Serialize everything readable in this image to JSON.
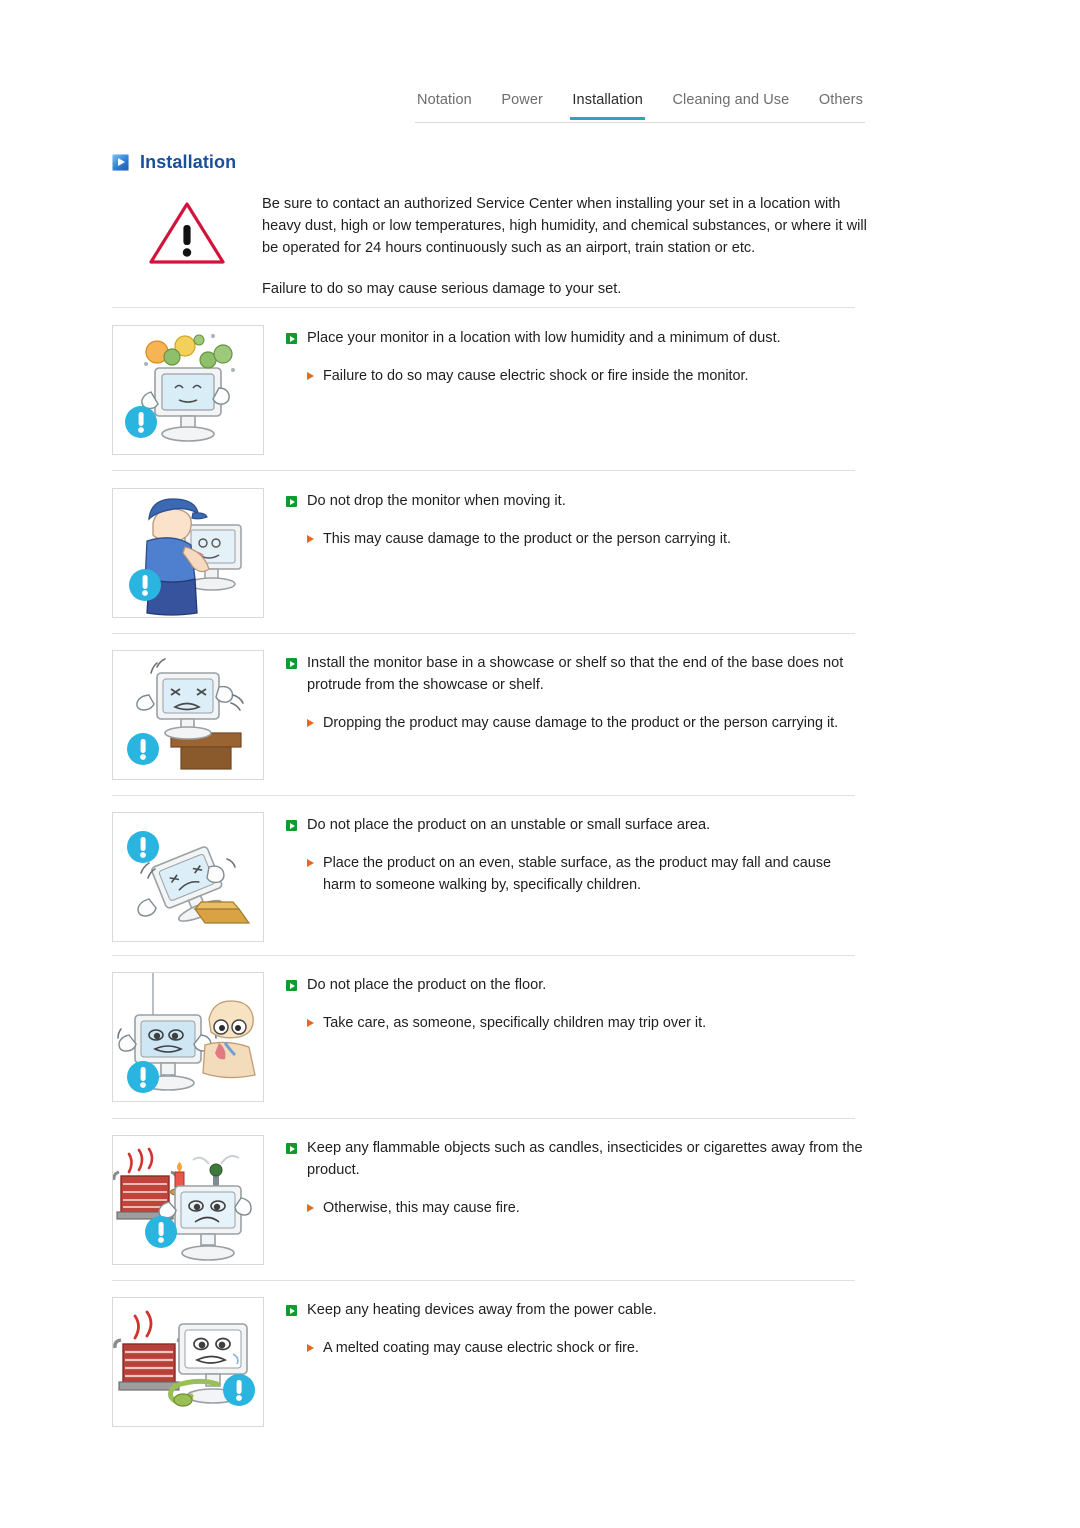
{
  "tabs": [
    {
      "label": "Notation",
      "active": false
    },
    {
      "label": "Power",
      "active": false
    },
    {
      "label": "Installation",
      "active": true
    },
    {
      "label": "Cleaning and Use",
      "active": false
    },
    {
      "label": "Others",
      "active": false
    }
  ],
  "header": {
    "title": "Installation",
    "icon": "blue-play-square-icon",
    "title_color": "#1b4f9c",
    "active_tab_underline_color": "#2aa7bd"
  },
  "intro": {
    "icon": "warning-triangle-icon",
    "icon_color": "#d1143c",
    "paragraph_1": "Be sure to contact an authorized Service Center when installing your set in a location with heavy dust, high or low temperatures, high humidity, and chemical substances, or where it will be operated for 24 hours continuously such as an airport, train station or etc.",
    "paragraph_2": "Failure to do so may cause serious damage to your set."
  },
  "colors": {
    "main_bullet": "#0f9b2e",
    "sub_bullet": "#e8671c",
    "caution_badge": "#2ab4e0",
    "divider": "#e0e0e0"
  },
  "rows": [
    {
      "illustration": "monitor-with-dust-particles-illustration",
      "badge": "caution-exclamation-badge",
      "main": "Place your monitor in a location with low humidity and a minimum of dust.",
      "sub": "Failure to do so may cause electric shock or fire inside the monitor."
    },
    {
      "illustration": "person-carrying-monitor-illustration",
      "badge": "caution-exclamation-badge",
      "main": "Do not drop the monitor when moving it.",
      "sub": "This may cause damage to the product or the person carrying it."
    },
    {
      "illustration": "monitor-on-shelf-edge-illustration",
      "badge": "caution-exclamation-badge",
      "main": "Install the monitor base in a showcase or shelf so that the end of the base does not protrude from the showcase or shelf.",
      "sub": "Dropping the product may cause damage to the product or the person carrying it."
    },
    {
      "illustration": "monitor-falling-off-small-surface-illustration",
      "badge": "caution-exclamation-badge",
      "main": "Do not place the product on an unstable or small surface area.",
      "sub": "Place the product on an even, stable surface, as the product may fall and cause harm to someone walking by, specifically children."
    },
    {
      "illustration": "monitor-on-floor-with-child-illustration",
      "badge": "caution-exclamation-badge",
      "main": "Do not place the product on the floor.",
      "sub": "Take care, as someone, specifically children may trip over it."
    },
    {
      "illustration": "heater-candle-near-monitor-illustration",
      "badge": "caution-exclamation-badge",
      "main": "Keep any flammable objects such as candles, insecticides or cigarettes away from the product.",
      "sub": "Otherwise, this may cause fire."
    },
    {
      "illustration": "heater-near-power-cable-illustration",
      "badge": "caution-exclamation-badge",
      "main": "Keep any heating devices away from the power cable.",
      "sub": "A melted coating may cause electric shock or fire."
    }
  ]
}
